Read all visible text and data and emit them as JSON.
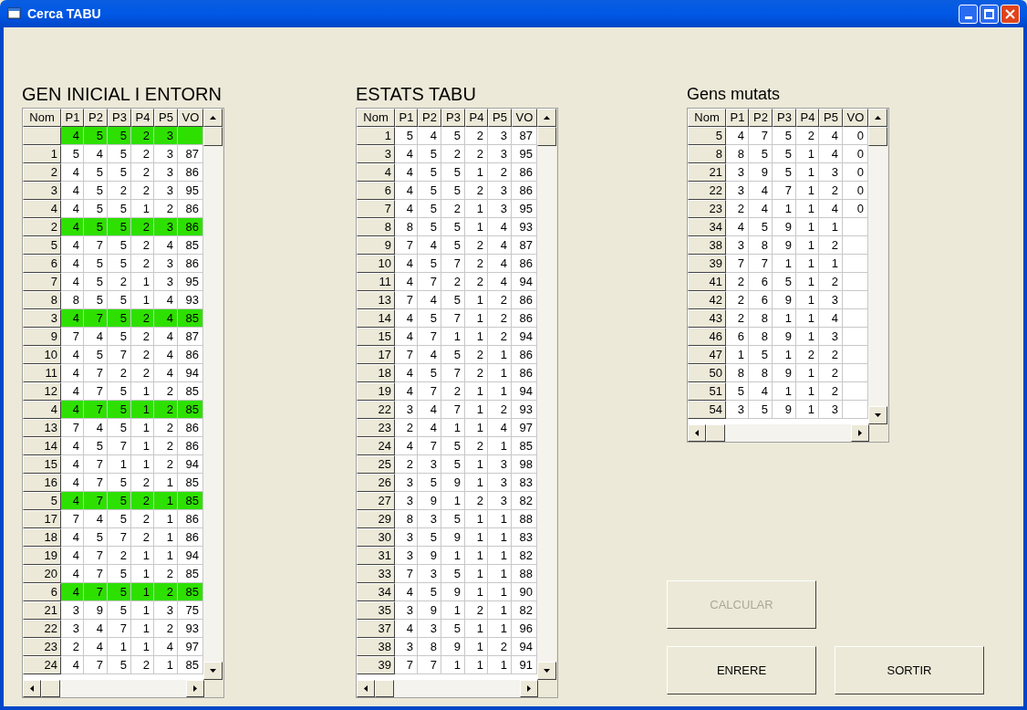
{
  "window": {
    "title": "Cerca TABU"
  },
  "panels": [
    {
      "heading": "GEN INICIAL I ENTORN",
      "columns": [
        "Nom",
        "P1",
        "P2",
        "P3",
        "P4",
        "P5",
        "VO"
      ],
      "rows": [
        {
          "cells": [
            "",
            "4",
            "5",
            "5",
            "2",
            "3",
            ""
          ],
          "highlighted": true
        },
        {
          "cells": [
            "1",
            "5",
            "4",
            "5",
            "2",
            "3",
            "87"
          ],
          "highlighted": false
        },
        {
          "cells": [
            "2",
            "4",
            "5",
            "5",
            "2",
            "3",
            "86"
          ],
          "highlighted": false
        },
        {
          "cells": [
            "3",
            "4",
            "5",
            "2",
            "2",
            "3",
            "95"
          ],
          "highlighted": false
        },
        {
          "cells": [
            "4",
            "4",
            "5",
            "5",
            "1",
            "2",
            "86"
          ],
          "highlighted": false
        },
        {
          "cells": [
            "2",
            "4",
            "5",
            "5",
            "2",
            "3",
            "86"
          ],
          "highlighted": true
        },
        {
          "cells": [
            "5",
            "4",
            "7",
            "5",
            "2",
            "4",
            "85"
          ],
          "highlighted": false
        },
        {
          "cells": [
            "6",
            "4",
            "5",
            "5",
            "2",
            "3",
            "86"
          ],
          "highlighted": false
        },
        {
          "cells": [
            "7",
            "4",
            "5",
            "2",
            "1",
            "3",
            "95"
          ],
          "highlighted": false
        },
        {
          "cells": [
            "8",
            "8",
            "5",
            "5",
            "1",
            "4",
            "93"
          ],
          "highlighted": false
        },
        {
          "cells": [
            "3",
            "4",
            "7",
            "5",
            "2",
            "4",
            "85"
          ],
          "highlighted": true
        },
        {
          "cells": [
            "9",
            "7",
            "4",
            "5",
            "2",
            "4",
            "87"
          ],
          "highlighted": false
        },
        {
          "cells": [
            "10",
            "4",
            "5",
            "7",
            "2",
            "4",
            "86"
          ],
          "highlighted": false
        },
        {
          "cells": [
            "11",
            "4",
            "7",
            "2",
            "2",
            "4",
            "94"
          ],
          "highlighted": false
        },
        {
          "cells": [
            "12",
            "4",
            "7",
            "5",
            "1",
            "2",
            "85"
          ],
          "highlighted": false
        },
        {
          "cells": [
            "4",
            "4",
            "7",
            "5",
            "1",
            "2",
            "85"
          ],
          "highlighted": true
        },
        {
          "cells": [
            "13",
            "7",
            "4",
            "5",
            "1",
            "2",
            "86"
          ],
          "highlighted": false
        },
        {
          "cells": [
            "14",
            "4",
            "5",
            "7",
            "1",
            "2",
            "86"
          ],
          "highlighted": false
        },
        {
          "cells": [
            "15",
            "4",
            "7",
            "1",
            "1",
            "2",
            "94"
          ],
          "highlighted": false
        },
        {
          "cells": [
            "16",
            "4",
            "7",
            "5",
            "2",
            "1",
            "85"
          ],
          "highlighted": false
        },
        {
          "cells": [
            "5",
            "4",
            "7",
            "5",
            "2",
            "1",
            "85"
          ],
          "highlighted": true
        },
        {
          "cells": [
            "17",
            "7",
            "4",
            "5",
            "2",
            "1",
            "86"
          ],
          "highlighted": false
        },
        {
          "cells": [
            "18",
            "4",
            "5",
            "7",
            "2",
            "1",
            "86"
          ],
          "highlighted": false
        },
        {
          "cells": [
            "19",
            "4",
            "7",
            "2",
            "1",
            "1",
            "94"
          ],
          "highlighted": false
        },
        {
          "cells": [
            "20",
            "4",
            "7",
            "5",
            "1",
            "2",
            "85"
          ],
          "highlighted": false
        },
        {
          "cells": [
            "6",
            "4",
            "7",
            "5",
            "1",
            "2",
            "85"
          ],
          "highlighted": true
        },
        {
          "cells": [
            "21",
            "3",
            "9",
            "5",
            "1",
            "3",
            "75"
          ],
          "highlighted": false
        },
        {
          "cells": [
            "22",
            "3",
            "4",
            "7",
            "1",
            "2",
            "93"
          ],
          "highlighted": false
        },
        {
          "cells": [
            "23",
            "2",
            "4",
            "1",
            "1",
            "4",
            "97"
          ],
          "highlighted": false
        },
        {
          "cells": [
            "24",
            "4",
            "7",
            "5",
            "2",
            "1",
            "85"
          ],
          "highlighted": false
        }
      ]
    },
    {
      "heading": "ESTATS TABU",
      "columns": [
        "Nom",
        "P1",
        "P2",
        "P3",
        "P4",
        "P5",
        "VO"
      ],
      "rows": [
        {
          "cells": [
            "1",
            "5",
            "4",
            "5",
            "2",
            "3",
            "87"
          ],
          "highlighted": false
        },
        {
          "cells": [
            "3",
            "4",
            "5",
            "2",
            "2",
            "3",
            "95"
          ],
          "highlighted": false
        },
        {
          "cells": [
            "4",
            "4",
            "5",
            "5",
            "1",
            "2",
            "86"
          ],
          "highlighted": false
        },
        {
          "cells": [
            "6",
            "4",
            "5",
            "5",
            "2",
            "3",
            "86"
          ],
          "highlighted": false
        },
        {
          "cells": [
            "7",
            "4",
            "5",
            "2",
            "1",
            "3",
            "95"
          ],
          "highlighted": false
        },
        {
          "cells": [
            "8",
            "8",
            "5",
            "5",
            "1",
            "4",
            "93"
          ],
          "highlighted": false
        },
        {
          "cells": [
            "9",
            "7",
            "4",
            "5",
            "2",
            "4",
            "87"
          ],
          "highlighted": false
        },
        {
          "cells": [
            "10",
            "4",
            "5",
            "7",
            "2",
            "4",
            "86"
          ],
          "highlighted": false
        },
        {
          "cells": [
            "11",
            "4",
            "7",
            "2",
            "2",
            "4",
            "94"
          ],
          "highlighted": false
        },
        {
          "cells": [
            "13",
            "7",
            "4",
            "5",
            "1",
            "2",
            "86"
          ],
          "highlighted": false
        },
        {
          "cells": [
            "14",
            "4",
            "5",
            "7",
            "1",
            "2",
            "86"
          ],
          "highlighted": false
        },
        {
          "cells": [
            "15",
            "4",
            "7",
            "1",
            "1",
            "2",
            "94"
          ],
          "highlighted": false
        },
        {
          "cells": [
            "17",
            "7",
            "4",
            "5",
            "2",
            "1",
            "86"
          ],
          "highlighted": false
        },
        {
          "cells": [
            "18",
            "4",
            "5",
            "7",
            "2",
            "1",
            "86"
          ],
          "highlighted": false
        },
        {
          "cells": [
            "19",
            "4",
            "7",
            "2",
            "1",
            "1",
            "94"
          ],
          "highlighted": false
        },
        {
          "cells": [
            "22",
            "3",
            "4",
            "7",
            "1",
            "2",
            "93"
          ],
          "highlighted": false
        },
        {
          "cells": [
            "23",
            "2",
            "4",
            "1",
            "1",
            "4",
            "97"
          ],
          "highlighted": false
        },
        {
          "cells": [
            "24",
            "4",
            "7",
            "5",
            "2",
            "1",
            "85"
          ],
          "highlighted": false
        },
        {
          "cells": [
            "25",
            "2",
            "3",
            "5",
            "1",
            "3",
            "98"
          ],
          "highlighted": false
        },
        {
          "cells": [
            "26",
            "3",
            "5",
            "9",
            "1",
            "3",
            "83"
          ],
          "highlighted": false
        },
        {
          "cells": [
            "27",
            "3",
            "9",
            "1",
            "2",
            "3",
            "82"
          ],
          "highlighted": false
        },
        {
          "cells": [
            "29",
            "8",
            "3",
            "5",
            "1",
            "1",
            "88"
          ],
          "highlighted": false
        },
        {
          "cells": [
            "30",
            "3",
            "5",
            "9",
            "1",
            "1",
            "83"
          ],
          "highlighted": false
        },
        {
          "cells": [
            "31",
            "3",
            "9",
            "1",
            "1",
            "1",
            "82"
          ],
          "highlighted": false
        },
        {
          "cells": [
            "33",
            "7",
            "3",
            "5",
            "1",
            "1",
            "88"
          ],
          "highlighted": false
        },
        {
          "cells": [
            "34",
            "4",
            "5",
            "9",
            "1",
            "1",
            "90"
          ],
          "highlighted": false
        },
        {
          "cells": [
            "35",
            "3",
            "9",
            "1",
            "2",
            "1",
            "82"
          ],
          "highlighted": false
        },
        {
          "cells": [
            "37",
            "4",
            "3",
            "5",
            "1",
            "1",
            "96"
          ],
          "highlighted": false
        },
        {
          "cells": [
            "38",
            "3",
            "8",
            "9",
            "1",
            "2",
            "94"
          ],
          "highlighted": false
        },
        {
          "cells": [
            "39",
            "7",
            "7",
            "1",
            "1",
            "1",
            "91"
          ],
          "highlighted": false
        }
      ]
    },
    {
      "heading": "Gens mutats",
      "columns": [
        "Nom",
        "P1",
        "P2",
        "P3",
        "P4",
        "P5",
        "VO"
      ],
      "rows": [
        {
          "cells": [
            "5",
            "4",
            "7",
            "5",
            "2",
            "4",
            "0"
          ],
          "highlighted": false
        },
        {
          "cells": [
            "8",
            "8",
            "5",
            "5",
            "1",
            "4",
            "0"
          ],
          "highlighted": false
        },
        {
          "cells": [
            "21",
            "3",
            "9",
            "5",
            "1",
            "3",
            "0"
          ],
          "highlighted": false
        },
        {
          "cells": [
            "22",
            "3",
            "4",
            "7",
            "1",
            "2",
            "0"
          ],
          "highlighted": false
        },
        {
          "cells": [
            "23",
            "2",
            "4",
            "1",
            "1",
            "4",
            "0"
          ],
          "highlighted": false
        },
        {
          "cells": [
            "34",
            "4",
            "5",
            "9",
            "1",
            "1",
            ""
          ],
          "highlighted": false
        },
        {
          "cells": [
            "38",
            "3",
            "8",
            "9",
            "1",
            "2",
            ""
          ],
          "highlighted": false
        },
        {
          "cells": [
            "39",
            "7",
            "7",
            "1",
            "1",
            "1",
            ""
          ],
          "highlighted": false
        },
        {
          "cells": [
            "41",
            "2",
            "6",
            "5",
            "1",
            "2",
            ""
          ],
          "highlighted": false
        },
        {
          "cells": [
            "42",
            "2",
            "6",
            "9",
            "1",
            "3",
            ""
          ],
          "highlighted": false
        },
        {
          "cells": [
            "43",
            "2",
            "8",
            "1",
            "1",
            "4",
            ""
          ],
          "highlighted": false
        },
        {
          "cells": [
            "46",
            "6",
            "8",
            "9",
            "1",
            "3",
            ""
          ],
          "highlighted": false
        },
        {
          "cells": [
            "47",
            "1",
            "5",
            "1",
            "2",
            "2",
            ""
          ],
          "highlighted": false
        },
        {
          "cells": [
            "50",
            "8",
            "8",
            "9",
            "1",
            "2",
            ""
          ],
          "highlighted": false
        },
        {
          "cells": [
            "51",
            "5",
            "4",
            "1",
            "1",
            "2",
            ""
          ],
          "highlighted": false
        },
        {
          "cells": [
            "54",
            "3",
            "5",
            "9",
            "1",
            "3",
            ""
          ],
          "highlighted": false
        }
      ]
    }
  ],
  "buttons": [
    {
      "label": "CALCULAR",
      "disabled": true
    },
    {
      "label": "ENRERE",
      "disabled": false
    },
    {
      "label": "SORTIR",
      "disabled": false
    }
  ]
}
